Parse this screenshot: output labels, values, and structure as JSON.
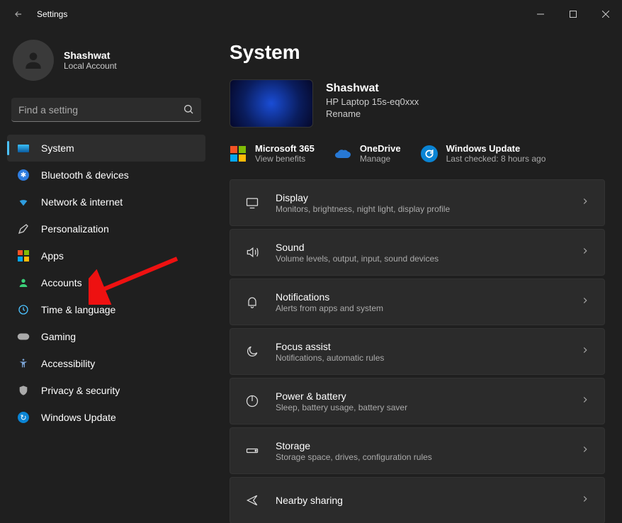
{
  "window": {
    "title": "Settings"
  },
  "profile": {
    "name": "Shashwat",
    "sub": "Local Account"
  },
  "search": {
    "placeholder": "Find a setting"
  },
  "sidebar": {
    "items": [
      {
        "label": "System"
      },
      {
        "label": "Bluetooth & devices"
      },
      {
        "label": "Network & internet"
      },
      {
        "label": "Personalization"
      },
      {
        "label": "Apps"
      },
      {
        "label": "Accounts"
      },
      {
        "label": "Time & language"
      },
      {
        "label": "Gaming"
      },
      {
        "label": "Accessibility"
      },
      {
        "label": "Privacy & security"
      },
      {
        "label": "Windows Update"
      }
    ]
  },
  "page": {
    "title": "System"
  },
  "device": {
    "name": "Shashwat",
    "model": "HP Laptop 15s-eq0xxx",
    "rename": "Rename"
  },
  "services": {
    "ms365": {
      "title": "Microsoft 365",
      "sub": "View benefits"
    },
    "onedrive": {
      "title": "OneDrive",
      "sub": "Manage"
    },
    "update": {
      "title": "Windows Update",
      "sub": "Last checked: 8 hours ago"
    }
  },
  "cards": [
    {
      "title": "Display",
      "sub": "Monitors, brightness, night light, display profile"
    },
    {
      "title": "Sound",
      "sub": "Volume levels, output, input, sound devices"
    },
    {
      "title": "Notifications",
      "sub": "Alerts from apps and system"
    },
    {
      "title": "Focus assist",
      "sub": "Notifications, automatic rules"
    },
    {
      "title": "Power & battery",
      "sub": "Sleep, battery usage, battery saver"
    },
    {
      "title": "Storage",
      "sub": "Storage space, drives, configuration rules"
    },
    {
      "title": "Nearby sharing",
      "sub": ""
    }
  ]
}
